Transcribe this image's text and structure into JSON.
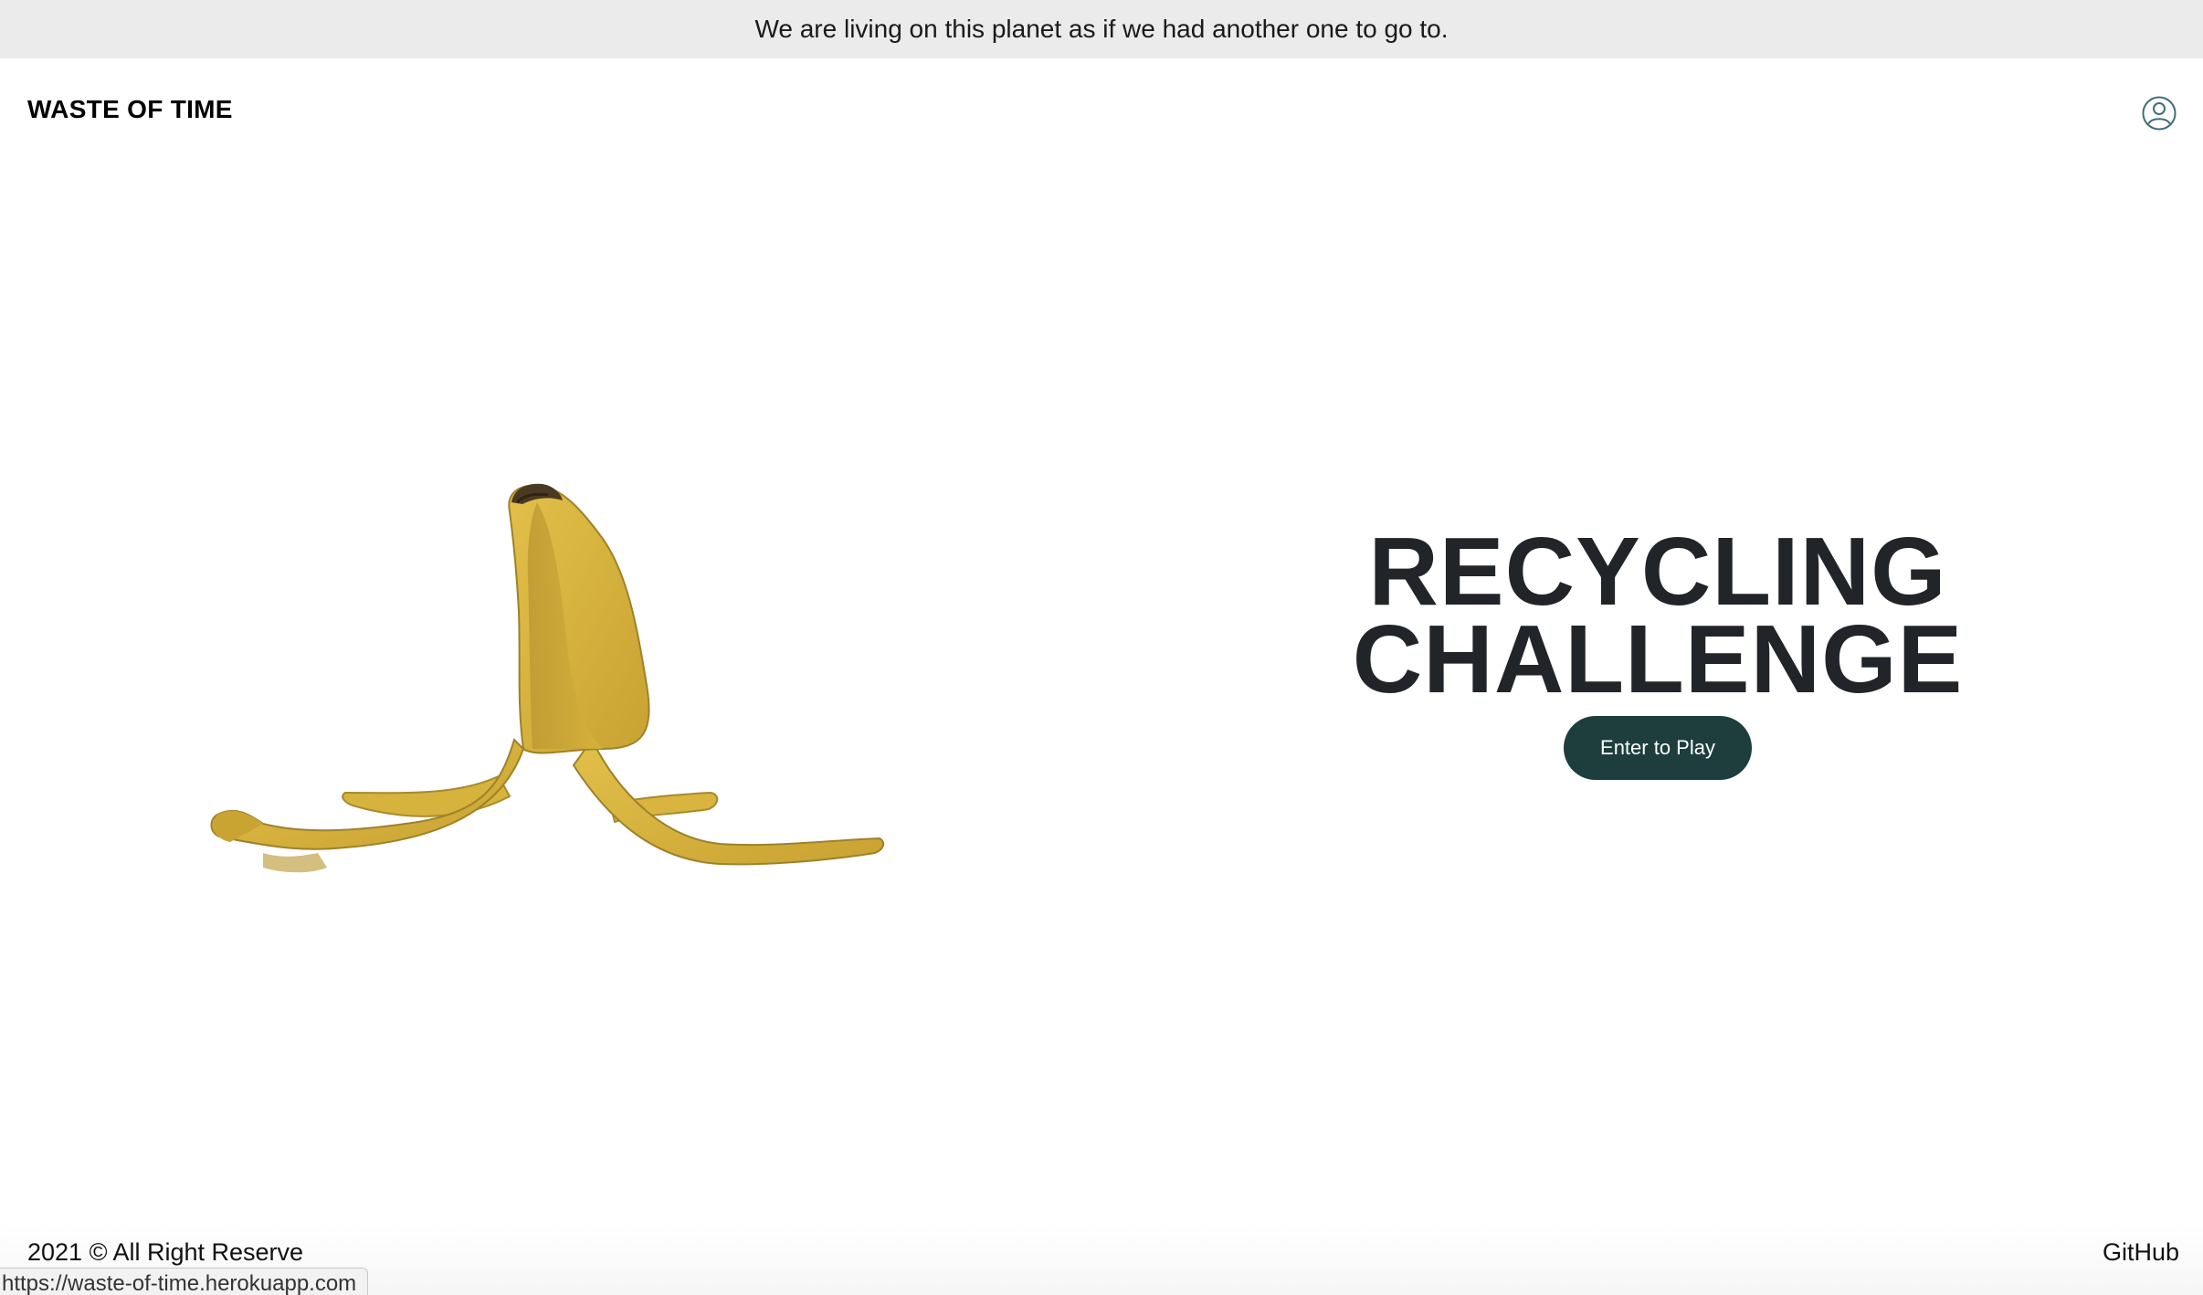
{
  "announcement": {
    "text": "We are living on this planet as if we had another one to go to."
  },
  "nav": {
    "brand": "WASTE OF TIME",
    "account_icon": "user-circle-icon"
  },
  "hero": {
    "image_subject": "banana-peel-icon",
    "title_line1": "RECYCLING",
    "title_line2": "CHALLENGE",
    "cta_label": "Enter to Play"
  },
  "footer": {
    "copyright": "2021 © All Right Reserve",
    "github_label": "GitHub"
  },
  "status_bar": {
    "url": "https://waste-of-time.herokuapp.com"
  },
  "colors": {
    "announcement_bg": "#ebebeb",
    "cta_bg": "#1e3d3d",
    "title": "#212529",
    "banana_yellow": "#d9b53a",
    "icon_stroke": "#3f6f78"
  }
}
